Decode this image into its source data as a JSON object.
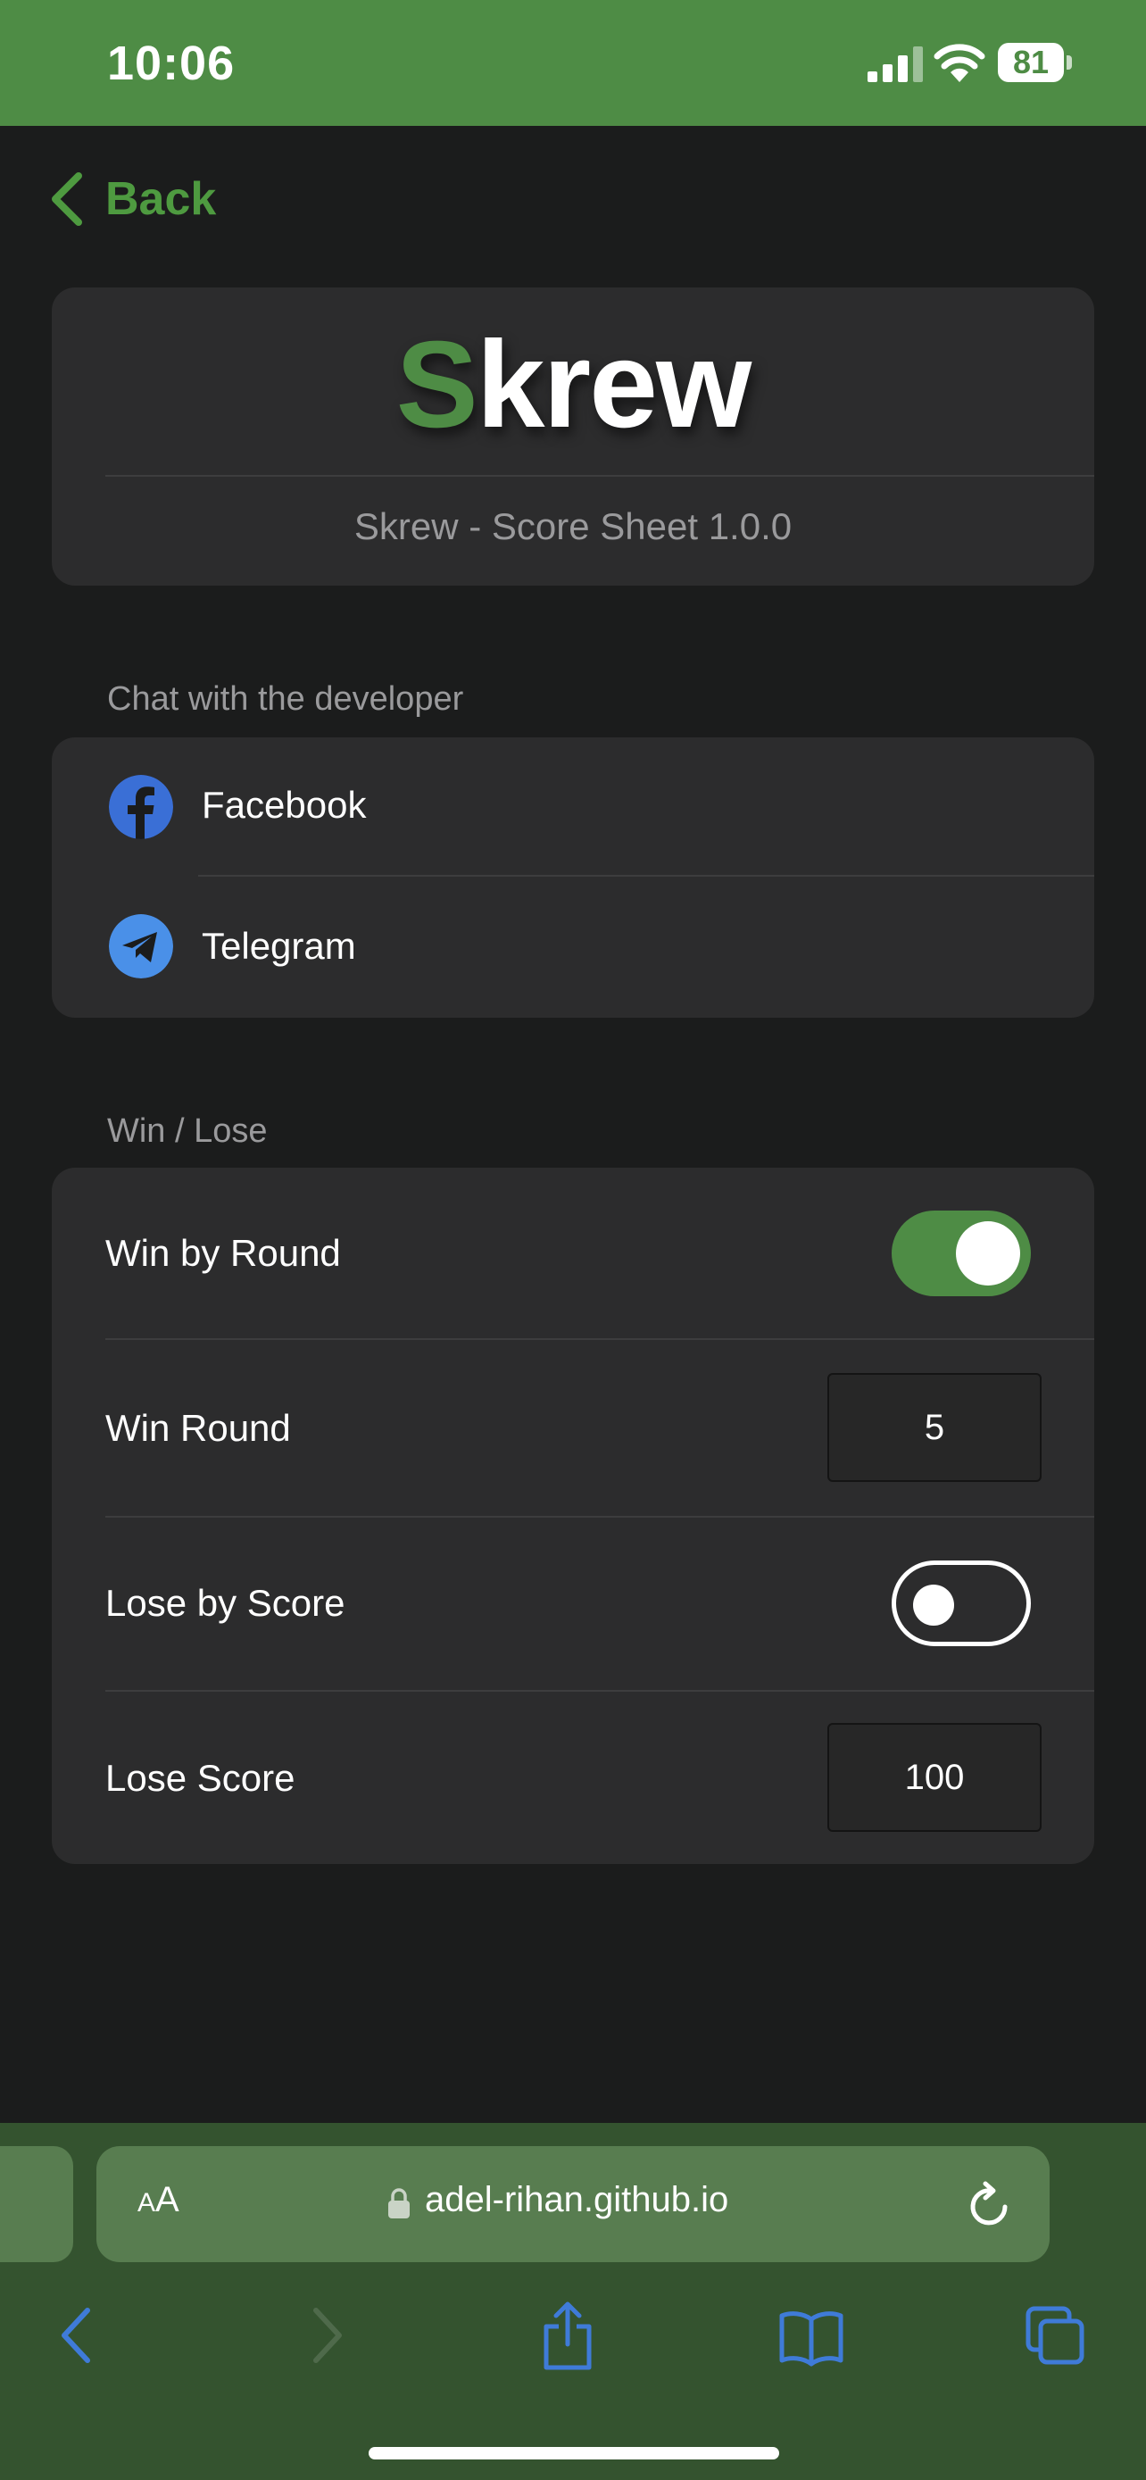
{
  "status_bar": {
    "time": "10:06",
    "battery": "81"
  },
  "nav": {
    "back_label": "Back"
  },
  "header": {
    "logo_first": "S",
    "logo_rest": "krew",
    "version": "Skrew - Score Sheet 1.0.0"
  },
  "contact": {
    "section_title": "Chat with the developer",
    "items": [
      {
        "label": "Facebook",
        "icon": "facebook-icon"
      },
      {
        "label": "Telegram",
        "icon": "telegram-icon"
      }
    ]
  },
  "settings": {
    "section_title": "Win / Lose",
    "win_by_round": {
      "label": "Win by Round",
      "enabled": true
    },
    "win_round": {
      "label": "Win Round",
      "value": "5"
    },
    "lose_by_score": {
      "label": "Lose by Score",
      "enabled": false
    },
    "lose_score": {
      "label": "Lose Score",
      "value": "100"
    }
  },
  "browser": {
    "text_size_label": "AA",
    "url": "adel-rihan.github.io"
  },
  "colors": {
    "accent": "#4e8c45",
    "background": "#1b1c1c",
    "card": "#2c2c2d",
    "facebook": "#3a6fd6",
    "telegram": "#4a90e8",
    "toolbar_icon": "#3f7bd8"
  }
}
